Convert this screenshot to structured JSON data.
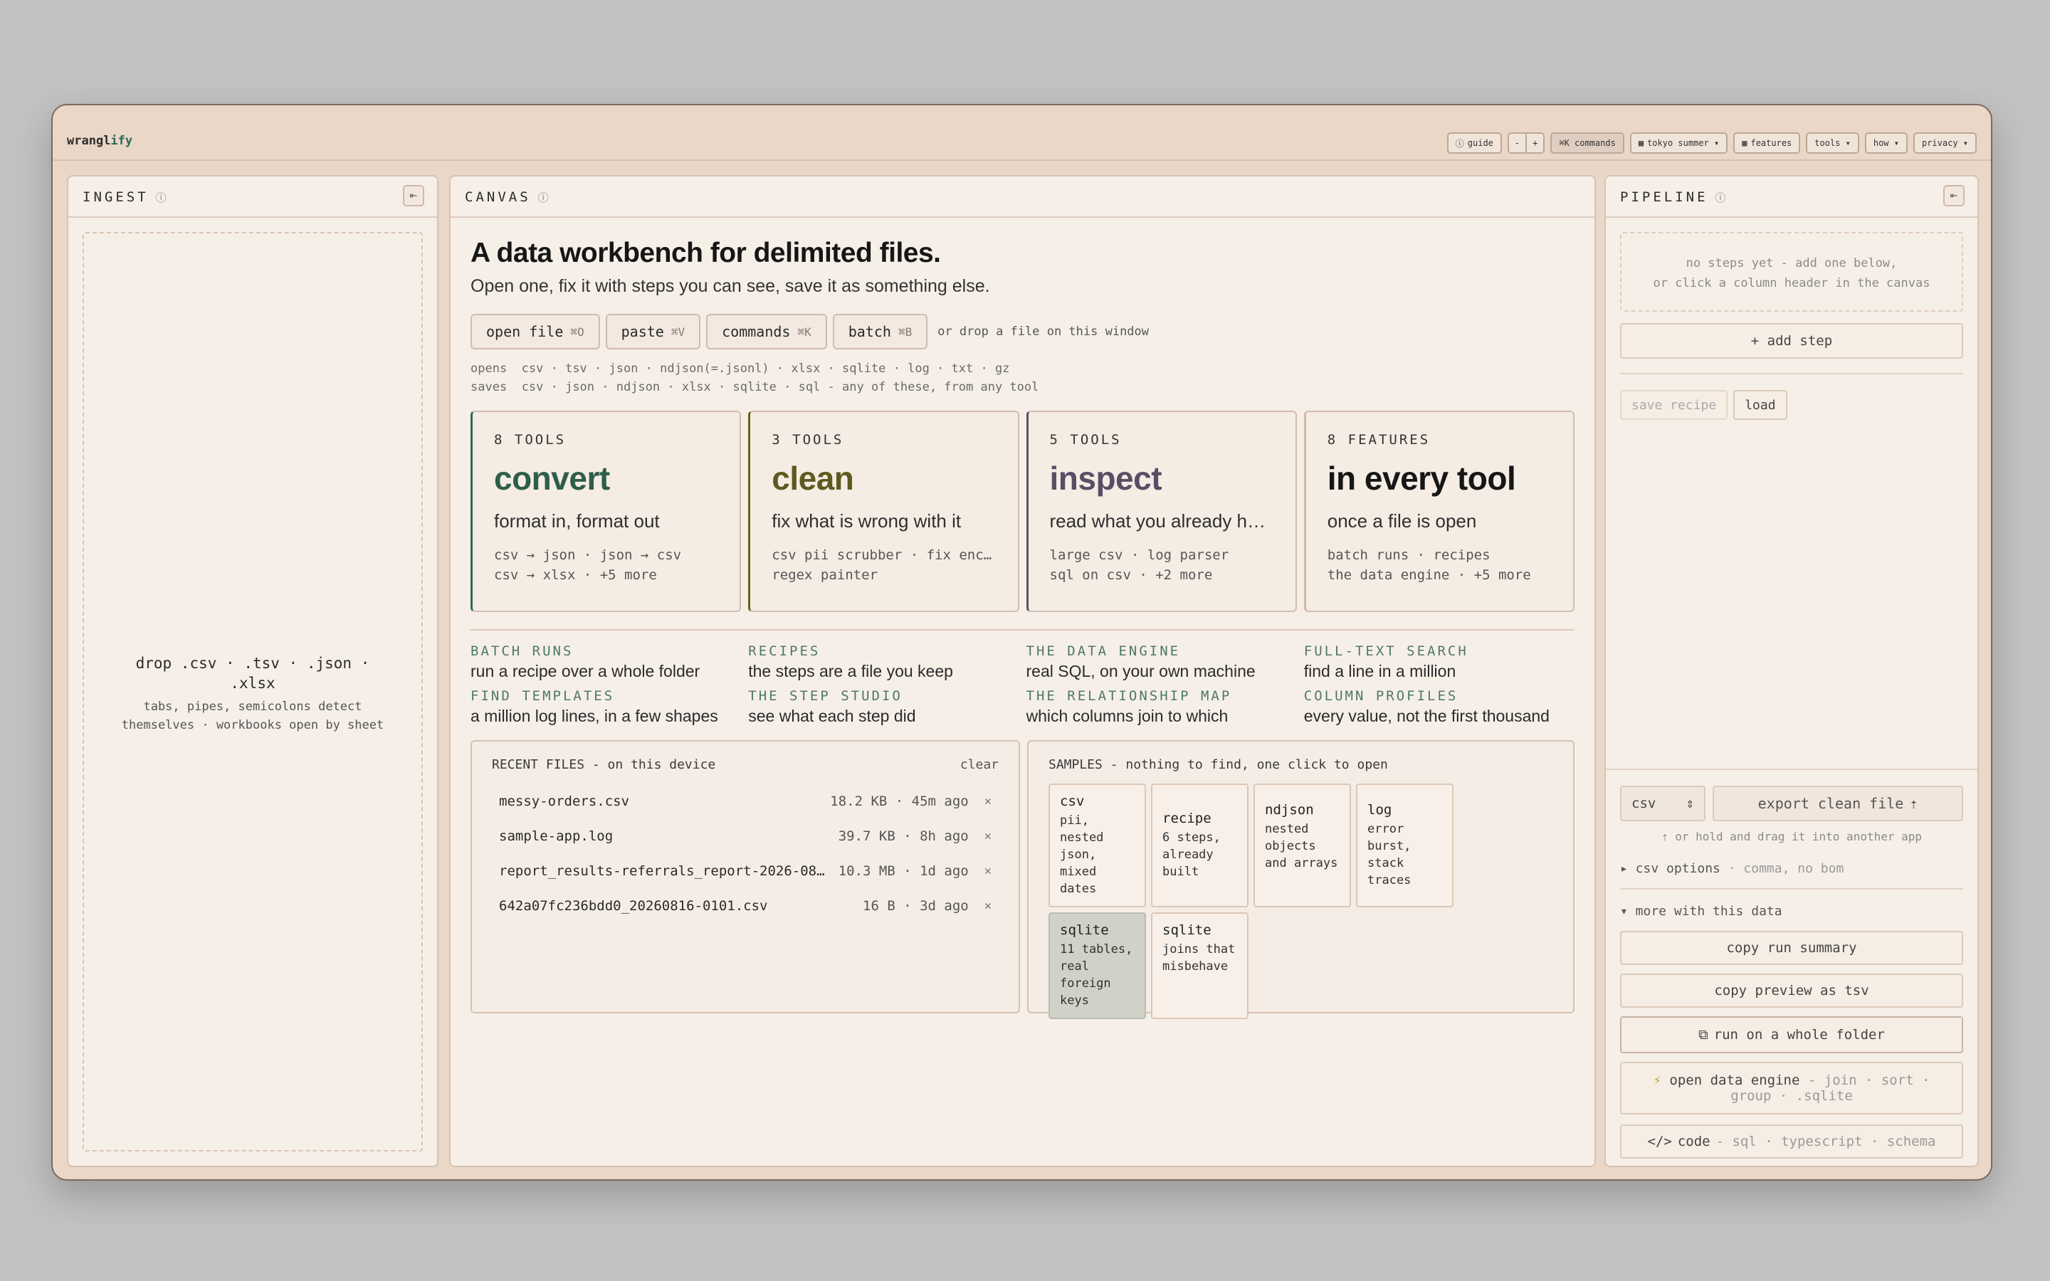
{
  "brand": {
    "part1": "wrangl",
    "part2": "ify"
  },
  "topbar": {
    "guide": "guide",
    "zoom_out": "-",
    "zoom_in": "+",
    "commands": "⌘K commands",
    "theme": "tokyo summer ▾",
    "features": "features",
    "tools": "tools ▾",
    "how": "how ▾",
    "privacy": "privacy ▾"
  },
  "ingest": {
    "title": "INGEST",
    "drop_main": "drop .csv · .tsv · .json · .xlsx",
    "drop_sub": "tabs, pipes, semicolons detect themselves · workbooks open by sheet"
  },
  "canvas": {
    "title": "CANVAS",
    "hero_title": "A data workbench for delimited files.",
    "hero_sub": "Open one, fix it with steps you can see, save it as something else.",
    "actions": [
      {
        "label": "open file",
        "kbd": "⌘O"
      },
      {
        "label": "paste",
        "kbd": "⌘V"
      },
      {
        "label": "commands",
        "kbd": "⌘K"
      },
      {
        "label": "batch",
        "kbd": "⌘B"
      }
    ],
    "drop_note": "or drop a file on this window",
    "opens_label": "opens",
    "opens": "csv · tsv · json · ndjson(=.jsonl) · xlsx · sqlite · log · txt · gz",
    "saves_label": "saves",
    "saves": "csv · json · ndjson · xlsx · sqlite · sql - any of these, from any tool",
    "cards": [
      {
        "count": "8 TOOLS",
        "name": "convert",
        "desc": "format in, format out",
        "tools1": "csv → json · json → csv",
        "tools2": "csv → xlsx · +5 more"
      },
      {
        "count": "3 TOOLS",
        "name": "clean",
        "desc": "fix what is wrong with it",
        "tools1": "csv pii scrubber · fix enc…",
        "tools2": "regex painter"
      },
      {
        "count": "5 TOOLS",
        "name": "inspect",
        "desc": "read what you already h…",
        "tools1": "large csv · log parser",
        "tools2": "sql on csv · +2 more"
      },
      {
        "count": "8 FEATURES",
        "name": "in every tool",
        "desc": "once a file is open",
        "tools1": "batch runs · recipes",
        "tools2": "the data engine · +5 more"
      }
    ],
    "features": [
      {
        "label": "BATCH RUNS",
        "text": "run a recipe over a whole folder"
      },
      {
        "label": "RECIPES",
        "text": "the steps are a file you keep"
      },
      {
        "label": "THE DATA ENGINE",
        "text": "real SQL, on your own machine"
      },
      {
        "label": "FULL-TEXT SEARCH",
        "text": "find a line in a million"
      },
      {
        "label": "FIND TEMPLATES",
        "text": "a million log lines, in a few shapes"
      },
      {
        "label": "THE STEP STUDIO",
        "text": "see what each step did"
      },
      {
        "label": "THE RELATIONSHIP MAP",
        "text": "which columns join to which"
      },
      {
        "label": "COLUMN PROFILES",
        "text": "every value, not the first thousand"
      }
    ],
    "recent": {
      "title": "RECENT FILES - on this device",
      "clear": "clear",
      "files": [
        {
          "name": "messy-orders.csv",
          "meta": "18.2 KB · 45m ago"
        },
        {
          "name": "sample-app.log",
          "meta": "39.7 KB · 8h ago"
        },
        {
          "name": "report_results-referrals_report-2026-08…",
          "meta": "10.3 MB · 1d ago"
        },
        {
          "name": "642a07fc236bdd0_20260816-0101.csv",
          "meta": "16 B · 3d ago"
        }
      ]
    },
    "samples": {
      "title": "SAMPLES - nothing to find, one click to open",
      "items": [
        {
          "name": "csv",
          "desc": "pii, nested json, mixed dates"
        },
        {
          "name": "recipe",
          "desc": "6 steps, already built"
        },
        {
          "name": "ndjson",
          "desc": "nested objects and arrays"
        },
        {
          "name": "log",
          "desc": "error burst, stack traces"
        },
        {
          "name": "sqlite",
          "desc": "11 tables, real foreign keys"
        },
        {
          "name": "sqlite",
          "desc": "joins that misbehave"
        }
      ]
    }
  },
  "pipeline": {
    "title": "PIPELINE",
    "empty1": "no steps yet - add one below,",
    "empty2": "or click a column header in the canvas",
    "add_step": "+ add step",
    "save_recipe": "save recipe",
    "load": "load",
    "format": "csv",
    "export": "export clean file",
    "drag_note": "⇡ or hold and drag it into another app",
    "csv_options": "▸ csv options",
    "csv_options_detail": "· comma, no bom",
    "more": "▾ more with this data",
    "copy_summary": "copy run summary",
    "copy_preview": "copy preview as tsv",
    "run_folder": "run on a whole folder",
    "engine_label": "open data engine",
    "engine_detail": "- join · sort · group · .sqlite",
    "code_label": "code",
    "code_detail": "- sql · typescript · schema"
  },
  "colors": {
    "accent": "#2d6a55",
    "clean": "#5e5a1f",
    "inspect": "#5a4e65",
    "frame": "#ead7c8"
  }
}
